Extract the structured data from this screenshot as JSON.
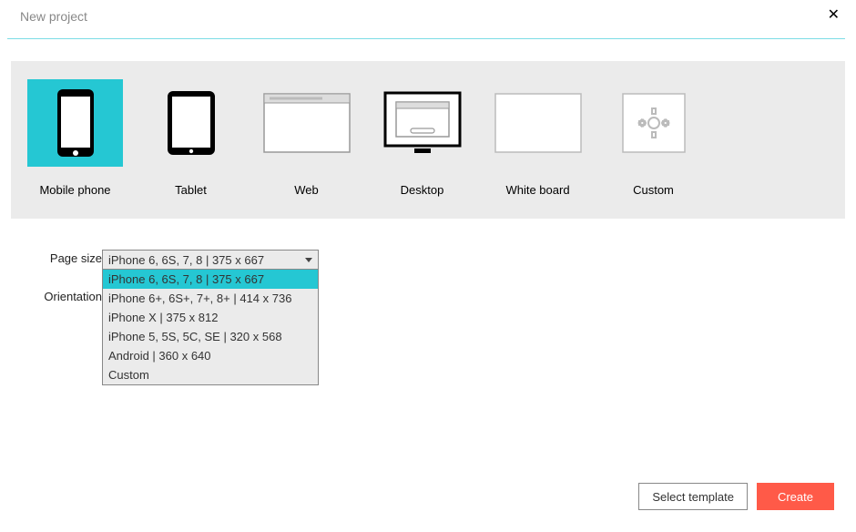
{
  "titlebar": {
    "title": "New project"
  },
  "devices": [
    {
      "key": "mobile",
      "label": "Mobile phone",
      "selected": true
    },
    {
      "key": "tablet",
      "label": "Tablet",
      "selected": false
    },
    {
      "key": "web",
      "label": "Web",
      "selected": false
    },
    {
      "key": "desktop",
      "label": "Desktop",
      "selected": false
    },
    {
      "key": "whiteboard",
      "label": "White board",
      "selected": false
    },
    {
      "key": "custom",
      "label": "Custom",
      "selected": false
    }
  ],
  "form": {
    "page_size_label": "Page size",
    "orientation_label": "Orientation",
    "page_size_value": "iPhone 6, 6S, 7, 8 | 375 x 667",
    "page_size_options": [
      "iPhone 6, 6S, 7, 8 | 375 x 667",
      "iPhone 6+, 6S+, 7+, 8+ | 414 x 736",
      "iPhone X | 375 x 812",
      "iPhone 5, 5S, 5C, SE | 320 x 568",
      "Android | 360 x 640",
      "Custom"
    ],
    "page_size_highlight_index": 0
  },
  "footer": {
    "select_template": "Select template",
    "create": "Create"
  }
}
